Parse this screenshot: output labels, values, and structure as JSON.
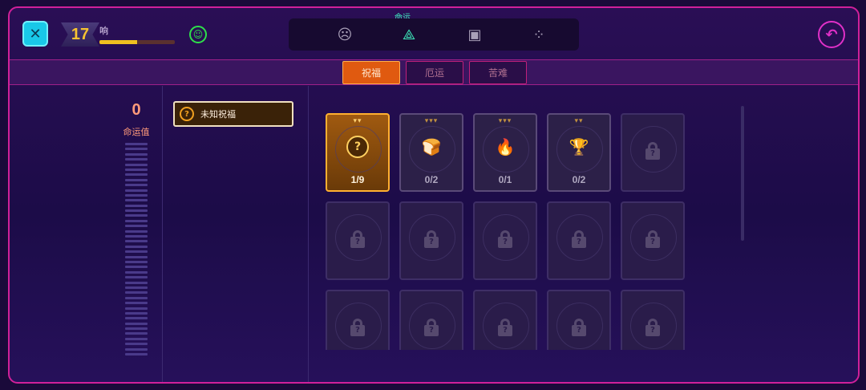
{
  "header": {
    "level": "17",
    "player_name": "响",
    "xp_fraction": 0.5,
    "active_tab_title": "命运",
    "tabs": [
      {
        "icon": "face-icon",
        "glyph": "☹"
      },
      {
        "icon": "triquetra-icon",
        "glyph": "⟁"
      },
      {
        "icon": "shield-puzzle-icon",
        "glyph": "▣"
      },
      {
        "icon": "dots-x-icon",
        "glyph": "⁘"
      }
    ]
  },
  "subtabs": [
    "祝福",
    "厄运",
    "苦难"
  ],
  "left_panel": {
    "fate_value": "0",
    "fate_label": "命运值"
  },
  "categories": [
    {
      "label": "未知祝福",
      "icon": "question-icon"
    }
  ],
  "cards": [
    {
      "tier": "▾▾",
      "icon": "question-orb-icon",
      "glyph": "?",
      "count": "1/9",
      "state": "selected"
    },
    {
      "tier": "▾▾▾",
      "icon": "bread-icon",
      "glyph": "🍞",
      "count": "0/2",
      "state": "unlocked"
    },
    {
      "tier": "▾▾▾",
      "icon": "fire-icon",
      "glyph": "🔥",
      "count": "0/1",
      "state": "unlocked"
    },
    {
      "tier": "▾▾",
      "icon": "cup-icon",
      "glyph": "🏆",
      "count": "0/2",
      "state": "unlocked"
    },
    {
      "state": "locked"
    },
    {
      "state": "locked"
    },
    {
      "state": "locked"
    },
    {
      "state": "locked"
    },
    {
      "state": "locked"
    },
    {
      "state": "locked"
    },
    {
      "state": "locked"
    },
    {
      "state": "locked"
    },
    {
      "state": "locked"
    },
    {
      "state": "locked"
    },
    {
      "state": "locked"
    }
  ]
}
